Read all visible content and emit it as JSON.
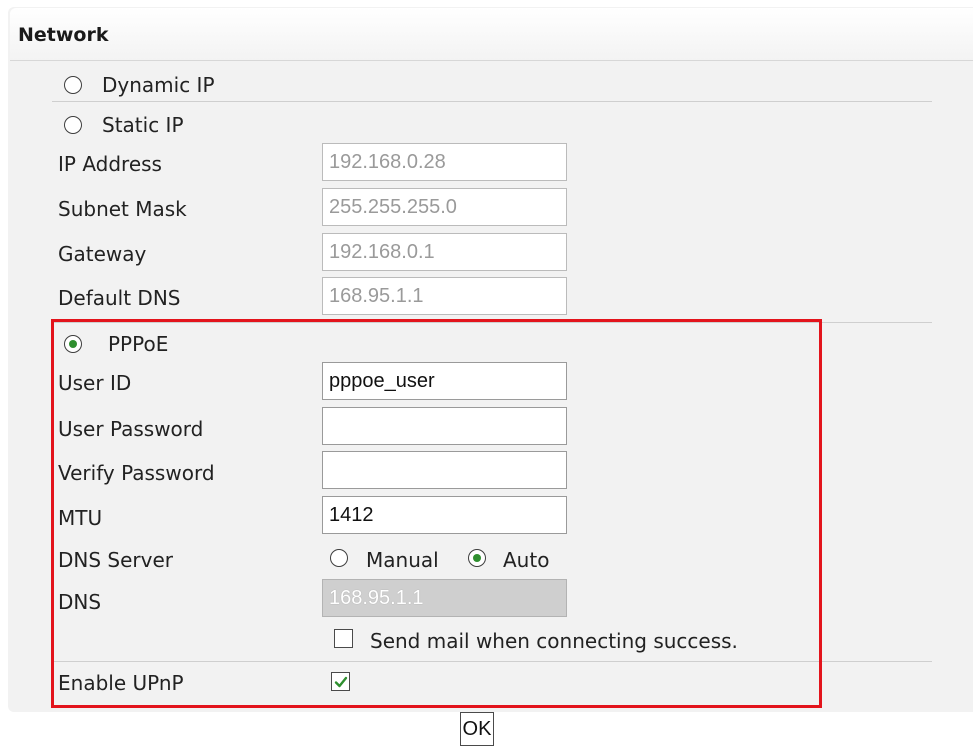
{
  "panel": {
    "title": "Network"
  },
  "modes": {
    "dynamic_ip": {
      "label": "Dynamic IP",
      "selected": false
    },
    "static_ip": {
      "label": "Static IP",
      "selected": false
    },
    "pppoe": {
      "label": "PPPoE",
      "selected": true
    }
  },
  "static": {
    "ip_address": {
      "label": "IP Address",
      "value": "192.168.0.28"
    },
    "subnet_mask": {
      "label": "Subnet Mask",
      "value": "255.255.255.0"
    },
    "gateway": {
      "label": "Gateway",
      "value": "192.168.0.1"
    },
    "default_dns": {
      "label": "Default DNS",
      "value": "168.95.1.1"
    }
  },
  "pppoe": {
    "user_id": {
      "label": "User ID",
      "value": "pppoe_user"
    },
    "user_password": {
      "label": "User Password",
      "value": ""
    },
    "verify_password": {
      "label": "Verify Password",
      "value": ""
    },
    "mtu": {
      "label": "MTU",
      "value": "1412"
    },
    "dns_server": {
      "label": "DNS Server",
      "manual_label": "Manual",
      "auto_label": "Auto",
      "selected": "Auto"
    },
    "dns": {
      "label": "DNS",
      "value": "168.95.1.1"
    },
    "send_mail": {
      "label": "Send mail when connecting success.",
      "checked": false
    }
  },
  "upnp": {
    "label": "Enable UPnP",
    "checked": true
  },
  "ok_label": "OK",
  "colors": {
    "highlight": "#e3141c",
    "radio_dot": "#2f8f2f",
    "check_mark": "#2f8f2f"
  }
}
